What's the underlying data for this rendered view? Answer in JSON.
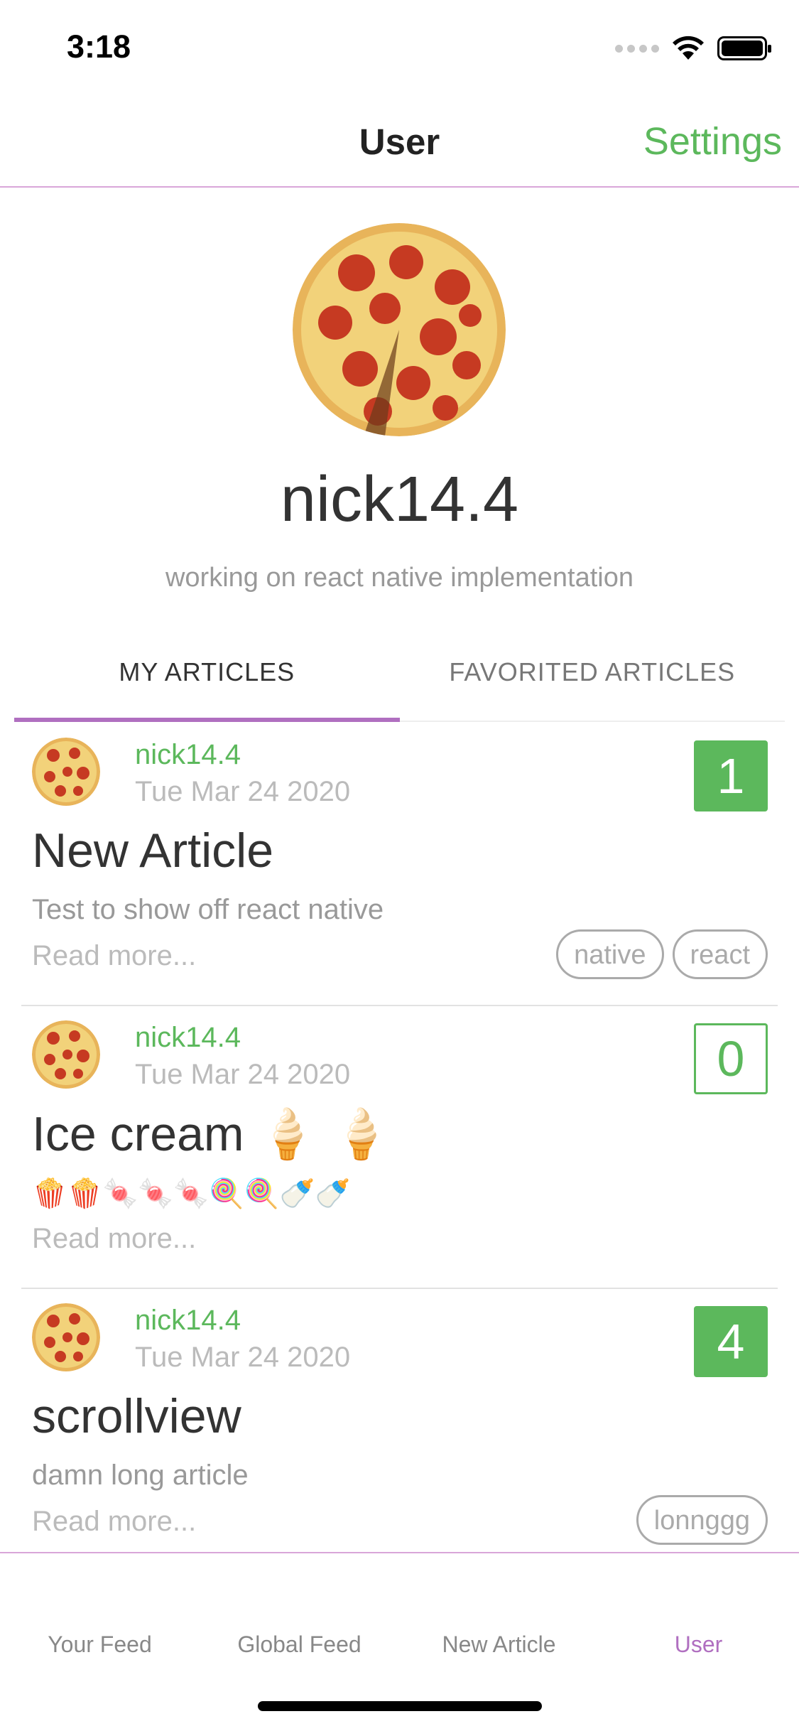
{
  "status_bar": {
    "time": "3:18"
  },
  "nav": {
    "title": "User",
    "settings_label": "Settings"
  },
  "profile": {
    "username": "nick14.4",
    "bio": "working on react native implementation"
  },
  "tabs": [
    {
      "label": "MY ARTICLES",
      "active": true
    },
    {
      "label": "FAVORITED ARTICLES",
      "active": false
    }
  ],
  "articles": [
    {
      "author": "nick14.4",
      "date": "Tue Mar 24 2020",
      "favorites": "1",
      "favorited": true,
      "title": "New Article",
      "description": "Test to show off react native",
      "read_more": "Read more...",
      "tags": [
        "native",
        "react"
      ]
    },
    {
      "author": "nick14.4",
      "date": "Tue Mar 24 2020",
      "favorites": "0",
      "favorited": false,
      "title": "Ice cream 🍦 🍦",
      "description": "🍿🍿🍬🍬🍬🍭🍭🍼🍼",
      "read_more": "Read more...",
      "tags": []
    },
    {
      "author": "nick14.4",
      "date": "Tue Mar 24 2020",
      "favorites": "4",
      "favorited": true,
      "title": "scrollview",
      "description": "damn long article",
      "read_more": "Read more...",
      "tags": [
        "lonnggg"
      ]
    }
  ],
  "tabbar": {
    "items": [
      {
        "label": "Your Feed",
        "active": false
      },
      {
        "label": "Global Feed",
        "active": false
      },
      {
        "label": "New Article",
        "active": false
      },
      {
        "label": "User",
        "active": true
      }
    ]
  },
  "colors": {
    "accent_green": "#5cb85c",
    "accent_purple": "#b06fc0",
    "divider_pink": "#d9a6d9"
  },
  "icons": [
    "signal-dots-icon",
    "wifi-icon",
    "battery-icon",
    "pizza-avatar"
  ]
}
